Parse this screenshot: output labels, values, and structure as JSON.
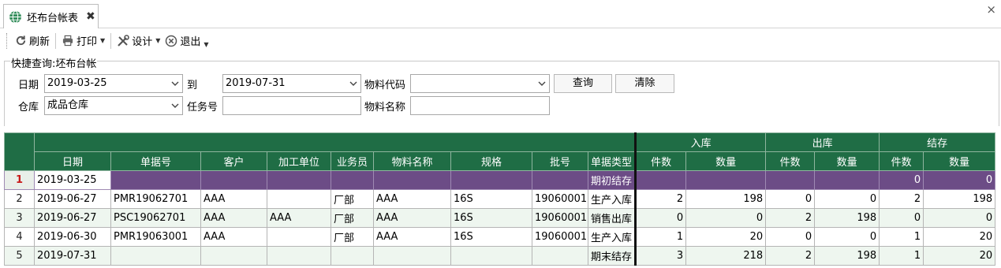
{
  "tab": {
    "title": "坯布台帐表",
    "close": "✖"
  },
  "window": {
    "close": "×"
  },
  "toolbar": {
    "refresh": "刷新",
    "print": "打印",
    "design": "设计",
    "exit": "退出"
  },
  "query": {
    "title": "快捷查询:坯布台帐",
    "date_label": "日期",
    "date_from": "2019-03-25",
    "to_label": "到",
    "date_to": "2019-07-31",
    "material_code_label": "物料代码",
    "material_code": "",
    "search_btn": "查询",
    "clear_btn": "清除",
    "warehouse_label": "仓库",
    "warehouse": "成品仓库",
    "task_label": "任务号",
    "task": "",
    "material_name_label": "物料名称",
    "material_name": ""
  },
  "grid": {
    "groups": {
      "in": "入库",
      "out": "出库",
      "stock": "结存"
    },
    "columns": {
      "date": "日期",
      "doc": "单据号",
      "customer": "客户",
      "processor": "加工单位",
      "salesman": "业务员",
      "material": "物料名称",
      "spec": "规格",
      "batch": "批号",
      "doctype": "单据类型",
      "pieces": "件数",
      "qty": "数量"
    },
    "rows": [
      {
        "n": "1",
        "date": "2019-03-25",
        "doc": "",
        "customer": "",
        "processor": "",
        "salesman": "",
        "material": "",
        "spec": "",
        "batch": "",
        "doctype": "期初结存",
        "in_p": "",
        "in_q": "",
        "out_p": "",
        "out_q": "",
        "st_p": "0",
        "st_q": "0"
      },
      {
        "n": "2",
        "date": "2019-06-27",
        "doc": "PMR19062701",
        "customer": "AAA",
        "processor": "",
        "salesman": "厂部",
        "material": "AAA",
        "spec": "16S",
        "batch": "19060001",
        "doctype": "生产入库",
        "in_p": "2",
        "in_q": "198",
        "out_p": "0",
        "out_q": "0",
        "st_p": "2",
        "st_q": "198"
      },
      {
        "n": "3",
        "date": "2019-06-27",
        "doc": "PSC19062701",
        "customer": "AAA",
        "processor": "AAA",
        "salesman": "厂部",
        "material": "AAA",
        "spec": "16S",
        "batch": "19060001",
        "doctype": "销售出库",
        "in_p": "0",
        "in_q": "0",
        "out_p": "2",
        "out_q": "198",
        "st_p": "0",
        "st_q": "0"
      },
      {
        "n": "4",
        "date": "2019-06-30",
        "doc": "PMR19063001",
        "customer": "AAA",
        "processor": "",
        "salesman": "厂部",
        "material": "AAA",
        "spec": "16S",
        "batch": "19060001",
        "doctype": "生产入库",
        "in_p": "1",
        "in_q": "20",
        "out_p": "0",
        "out_q": "0",
        "st_p": "1",
        "st_q": "20"
      },
      {
        "n": "5",
        "date": "2019-07-31",
        "doc": "",
        "customer": "",
        "processor": "",
        "salesman": "",
        "material": "",
        "spec": "",
        "batch": "",
        "doctype": "期末结存",
        "in_p": "3",
        "in_q": "218",
        "out_p": "2",
        "out_q": "198",
        "st_p": "1",
        "st_q": "20"
      }
    ]
  },
  "colors": {
    "header_green": "#1f6d45",
    "selected_row": "#6c4c86",
    "alt_row": "#eef6ef"
  }
}
